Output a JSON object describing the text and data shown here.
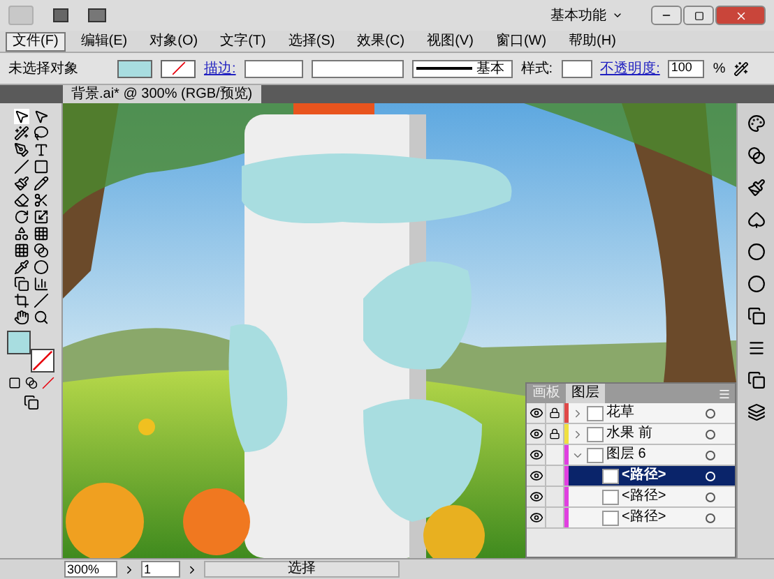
{
  "title_bar": {
    "workspace": "基本功能"
  },
  "menu": [
    {
      "label": "文件(F)",
      "selected": true
    },
    {
      "label": "编辑(E)",
      "selected": false
    },
    {
      "label": "对象(O)",
      "selected": false
    },
    {
      "label": "文字(T)",
      "selected": false
    },
    {
      "label": "选择(S)",
      "selected": false
    },
    {
      "label": "效果(C)",
      "selected": false
    },
    {
      "label": "视图(V)",
      "selected": false
    },
    {
      "label": "窗口(W)",
      "selected": false
    },
    {
      "label": "帮助(H)",
      "selected": false
    }
  ],
  "control_bar": {
    "selection": "未选择对象",
    "stroke_label": "描边:",
    "brush": "基本",
    "style_label": "样式:",
    "opacity_label": "不透明度:",
    "opacity": "100",
    "percent": "%"
  },
  "document_tab": {
    "title": "背景.ai* @ 300% (RGB/预览)"
  },
  "layers_panel": {
    "tabs": [
      {
        "label": "画板",
        "selected": false
      },
      {
        "label": "图层",
        "selected": true
      }
    ],
    "layers": [
      {
        "name": "花草",
        "locked": true,
        "color": "#e04848",
        "expanded": false,
        "selected": false
      },
      {
        "name": "水果 前",
        "locked": true,
        "color": "#f0e040",
        "expanded": false,
        "selected": false
      },
      {
        "name": "图层 6",
        "locked": false,
        "color": "#e040e0",
        "expanded": true,
        "selected": false,
        "children": [
          {
            "name": "<路径>",
            "selected": true
          },
          {
            "name": "<路径>",
            "selected": false
          },
          {
            "name": "<路径>",
            "selected": false
          }
        ]
      }
    ]
  },
  "status_bar": {
    "zoom": "300%",
    "artboard": "1",
    "tool": "选择"
  }
}
